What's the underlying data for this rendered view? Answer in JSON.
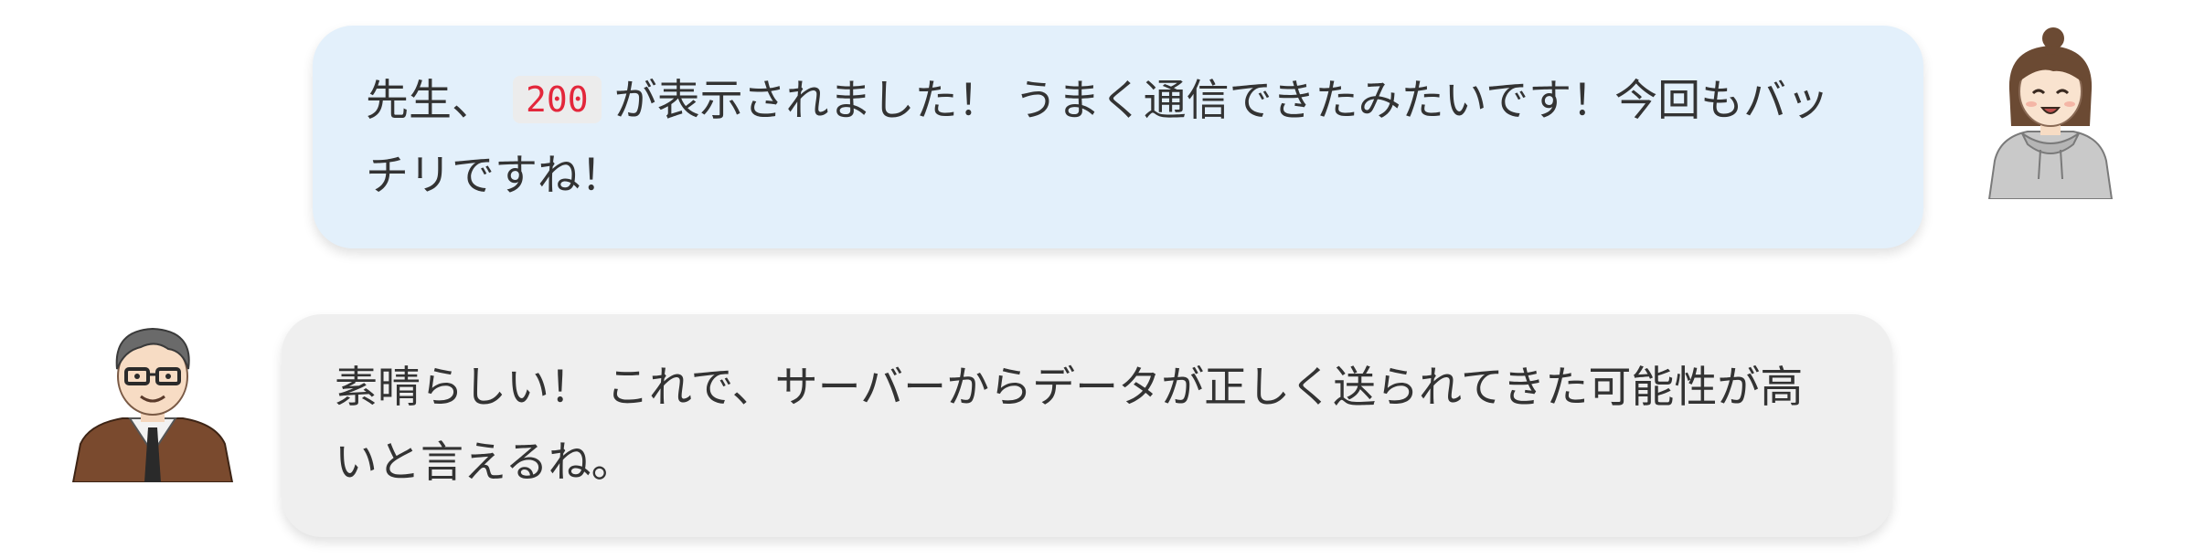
{
  "messages": [
    {
      "side": "right",
      "speaker_icon": "student-girl-icon",
      "text_before": "先生、",
      "code": "200",
      "text_after": "が表示されました！ うまく通信できたみたいです！今回もバッチリですね！",
      "bubble_color": "#e3f0fb"
    },
    {
      "side": "left",
      "speaker_icon": "teacher-man-icon",
      "text": "素晴らしい！ これで、サーバーからデータが正しく送られてきた可能性が高いと言えるね。",
      "bubble_color": "#efefef"
    }
  ],
  "colors": {
    "code_text": "#e3273b",
    "code_bg": "#ececec",
    "body_text": "#333333"
  }
}
